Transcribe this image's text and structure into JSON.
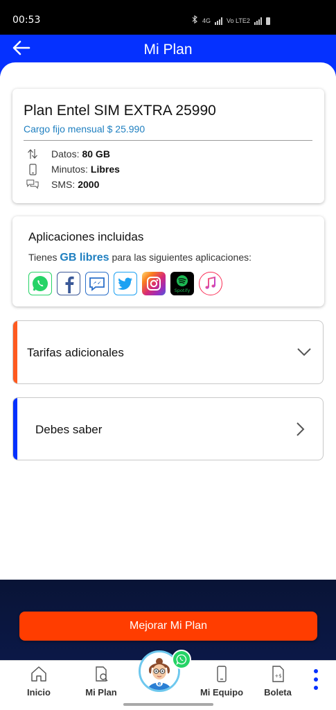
{
  "status_bar": {
    "time": "00:53",
    "network_4g": "4G",
    "network_volte": "Vo LTE2"
  },
  "header": {
    "title": "Mi Plan",
    "back_icon": "back-arrow-icon"
  },
  "plan": {
    "name": "Plan Entel SIM EXTRA 25990",
    "price": "Cargo fijo mensual $ 25.990",
    "features": [
      {
        "icon": "data-arrows-icon",
        "label": "Datos:",
        "value": "80 GB"
      },
      {
        "icon": "phone-icon",
        "label": "Minutos:",
        "value": "Libres"
      },
      {
        "icon": "sms-chat-icon",
        "label": "SMS:",
        "value": "2000"
      }
    ]
  },
  "apps": {
    "title": "Aplicaciones incluidas",
    "text_before": "Tienes",
    "highlight": "GB libres",
    "text_after": "para las siguientes aplicaciones:",
    "spotify_label": "Spotify",
    "items": [
      {
        "name": "WhatsApp",
        "icon": "whatsapp-icon",
        "color": "#25d366"
      },
      {
        "name": "Facebook",
        "icon": "facebook-icon",
        "color": "#3b5998"
      },
      {
        "name": "Messenger",
        "icon": "messenger-icon",
        "color": "#2a6fc9"
      },
      {
        "name": "Twitter",
        "icon": "twitter-icon",
        "color": "#1da1f2"
      },
      {
        "name": "Instagram",
        "icon": "instagram-icon",
        "color": "#e1306c"
      },
      {
        "name": "Spotify",
        "icon": "spotify-icon",
        "color": "#1db954"
      },
      {
        "name": "Apple Music",
        "icon": "apple-music-icon",
        "color": "#fa2d55"
      }
    ]
  },
  "accordions": [
    {
      "label": "Tarifas adicionales",
      "stripe_color": "#ff5a1f",
      "icon": "chevron-down-icon"
    },
    {
      "label": "Debes saber",
      "stripe_color": "#0531ff",
      "icon": "chevron-right-icon"
    }
  ],
  "cta": {
    "label": "Mejorar Mi Plan",
    "color": "#ff3d00"
  },
  "tabs": [
    {
      "label": "Inicio",
      "icon": "home-icon"
    },
    {
      "label": "Mi Plan",
      "icon": "plan-document-icon"
    },
    {
      "label": "Mi Equipo",
      "icon": "smartphone-icon"
    },
    {
      "label": "Boleta",
      "icon": "bill-icon"
    }
  ],
  "colors": {
    "brand_blue": "#0531ff",
    "accent_orange": "#ff3d00",
    "link_blue": "#1e7fc0"
  }
}
